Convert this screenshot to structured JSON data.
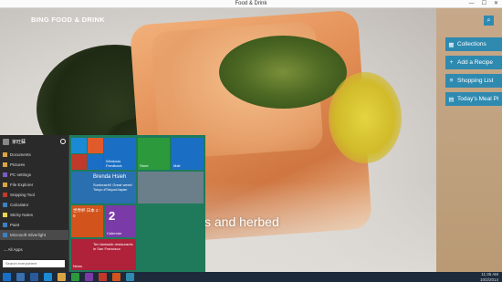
{
  "window": {
    "title": "Food & Drink",
    "minimize": "—",
    "maximize": "☐",
    "close": "✕"
  },
  "hero": {
    "brand": "BING FOOD & DRINK",
    "caption": "s and herbed"
  },
  "rightpanel": {
    "search_icon": "search-icon",
    "buttons": [
      {
        "label": "Collections",
        "icon": "grid-icon",
        "glyph": "▦"
      },
      {
        "label": "Add a Recipe",
        "icon": "plus-icon",
        "glyph": "+"
      },
      {
        "label": "Shopping List",
        "icon": "list-icon",
        "glyph": "≡"
      },
      {
        "label": "Today's Meal Pl",
        "icon": "calendar-icon",
        "glyph": "▤"
      }
    ],
    "accent": "#2f8ab0"
  },
  "startmenu": {
    "user": "家旺蘇",
    "apps": [
      {
        "label": "Documents",
        "color": "#d9a441"
      },
      {
        "label": "Pictures",
        "color": "#d9a441"
      },
      {
        "label": "PC settings",
        "color": "#7a5cc2"
      },
      {
        "label": "File Explorer",
        "color": "#d9a441"
      },
      {
        "label": "Snipping Tool",
        "color": "#c0392b"
      },
      {
        "label": "Calculator",
        "color": "#3b7fc4"
      },
      {
        "label": "Sticky Notes",
        "color": "#e8d44d"
      },
      {
        "label": "Paint",
        "color": "#3b7fc4"
      },
      {
        "label": "Microsoft Silverlight",
        "color": "#3b7fc4"
      }
    ],
    "all_apps": "All Apps",
    "search_placeholder": "Search everywhere",
    "tiles": {
      "feedback": "Windows Feedback",
      "store": "Store",
      "mail": "Mail",
      "people_name": "Brenda Hsieh",
      "people_text": "Sunbeach!! Great week! Tokyo #Tokyo#Japan",
      "finance_text": "世界杯 日本 2 : 0",
      "calendar_day": "2",
      "calendar_label": "Calendar",
      "news_text": "Ten fantastic restaurants in San Francisco",
      "news_label": "News"
    }
  },
  "taskbar": {
    "time": "11:35 AM",
    "date": "10/2/2014"
  }
}
